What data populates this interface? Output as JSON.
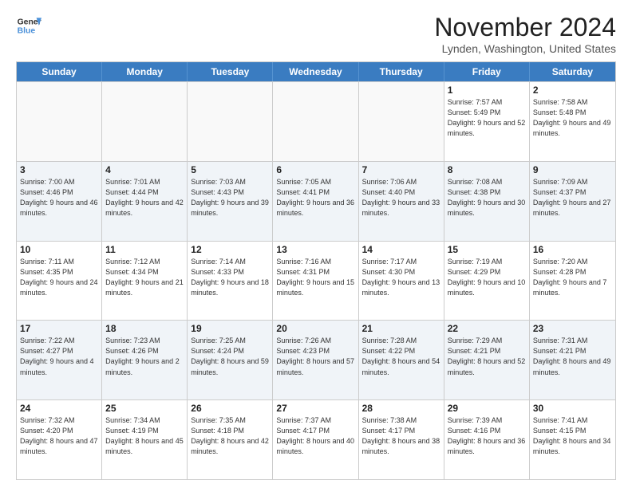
{
  "logo": {
    "line1": "General",
    "line2": "Blue"
  },
  "title": "November 2024",
  "location": "Lynden, Washington, United States",
  "days_of_week": [
    "Sunday",
    "Monday",
    "Tuesday",
    "Wednesday",
    "Thursday",
    "Friday",
    "Saturday"
  ],
  "weeks": [
    [
      {
        "day": "",
        "sunrise": "",
        "sunset": "",
        "daylight": ""
      },
      {
        "day": "",
        "sunrise": "",
        "sunset": "",
        "daylight": ""
      },
      {
        "day": "",
        "sunrise": "",
        "sunset": "",
        "daylight": ""
      },
      {
        "day": "",
        "sunrise": "",
        "sunset": "",
        "daylight": ""
      },
      {
        "day": "",
        "sunrise": "",
        "sunset": "",
        "daylight": ""
      },
      {
        "day": "1",
        "sunrise": "Sunrise: 7:57 AM",
        "sunset": "Sunset: 5:49 PM",
        "daylight": "Daylight: 9 hours and 52 minutes."
      },
      {
        "day": "2",
        "sunrise": "Sunrise: 7:58 AM",
        "sunset": "Sunset: 5:48 PM",
        "daylight": "Daylight: 9 hours and 49 minutes."
      }
    ],
    [
      {
        "day": "3",
        "sunrise": "Sunrise: 7:00 AM",
        "sunset": "Sunset: 4:46 PM",
        "daylight": "Daylight: 9 hours and 46 minutes."
      },
      {
        "day": "4",
        "sunrise": "Sunrise: 7:01 AM",
        "sunset": "Sunset: 4:44 PM",
        "daylight": "Daylight: 9 hours and 42 minutes."
      },
      {
        "day": "5",
        "sunrise": "Sunrise: 7:03 AM",
        "sunset": "Sunset: 4:43 PM",
        "daylight": "Daylight: 9 hours and 39 minutes."
      },
      {
        "day": "6",
        "sunrise": "Sunrise: 7:05 AM",
        "sunset": "Sunset: 4:41 PM",
        "daylight": "Daylight: 9 hours and 36 minutes."
      },
      {
        "day": "7",
        "sunrise": "Sunrise: 7:06 AM",
        "sunset": "Sunset: 4:40 PM",
        "daylight": "Daylight: 9 hours and 33 minutes."
      },
      {
        "day": "8",
        "sunrise": "Sunrise: 7:08 AM",
        "sunset": "Sunset: 4:38 PM",
        "daylight": "Daylight: 9 hours and 30 minutes."
      },
      {
        "day": "9",
        "sunrise": "Sunrise: 7:09 AM",
        "sunset": "Sunset: 4:37 PM",
        "daylight": "Daylight: 9 hours and 27 minutes."
      }
    ],
    [
      {
        "day": "10",
        "sunrise": "Sunrise: 7:11 AM",
        "sunset": "Sunset: 4:35 PM",
        "daylight": "Daylight: 9 hours and 24 minutes."
      },
      {
        "day": "11",
        "sunrise": "Sunrise: 7:12 AM",
        "sunset": "Sunset: 4:34 PM",
        "daylight": "Daylight: 9 hours and 21 minutes."
      },
      {
        "day": "12",
        "sunrise": "Sunrise: 7:14 AM",
        "sunset": "Sunset: 4:33 PM",
        "daylight": "Daylight: 9 hours and 18 minutes."
      },
      {
        "day": "13",
        "sunrise": "Sunrise: 7:16 AM",
        "sunset": "Sunset: 4:31 PM",
        "daylight": "Daylight: 9 hours and 15 minutes."
      },
      {
        "day": "14",
        "sunrise": "Sunrise: 7:17 AM",
        "sunset": "Sunset: 4:30 PM",
        "daylight": "Daylight: 9 hours and 13 minutes."
      },
      {
        "day": "15",
        "sunrise": "Sunrise: 7:19 AM",
        "sunset": "Sunset: 4:29 PM",
        "daylight": "Daylight: 9 hours and 10 minutes."
      },
      {
        "day": "16",
        "sunrise": "Sunrise: 7:20 AM",
        "sunset": "Sunset: 4:28 PM",
        "daylight": "Daylight: 9 hours and 7 minutes."
      }
    ],
    [
      {
        "day": "17",
        "sunrise": "Sunrise: 7:22 AM",
        "sunset": "Sunset: 4:27 PM",
        "daylight": "Daylight: 9 hours and 4 minutes."
      },
      {
        "day": "18",
        "sunrise": "Sunrise: 7:23 AM",
        "sunset": "Sunset: 4:26 PM",
        "daylight": "Daylight: 9 hours and 2 minutes."
      },
      {
        "day": "19",
        "sunrise": "Sunrise: 7:25 AM",
        "sunset": "Sunset: 4:24 PM",
        "daylight": "Daylight: 8 hours and 59 minutes."
      },
      {
        "day": "20",
        "sunrise": "Sunrise: 7:26 AM",
        "sunset": "Sunset: 4:23 PM",
        "daylight": "Daylight: 8 hours and 57 minutes."
      },
      {
        "day": "21",
        "sunrise": "Sunrise: 7:28 AM",
        "sunset": "Sunset: 4:22 PM",
        "daylight": "Daylight: 8 hours and 54 minutes."
      },
      {
        "day": "22",
        "sunrise": "Sunrise: 7:29 AM",
        "sunset": "Sunset: 4:21 PM",
        "daylight": "Daylight: 8 hours and 52 minutes."
      },
      {
        "day": "23",
        "sunrise": "Sunrise: 7:31 AM",
        "sunset": "Sunset: 4:21 PM",
        "daylight": "Daylight: 8 hours and 49 minutes."
      }
    ],
    [
      {
        "day": "24",
        "sunrise": "Sunrise: 7:32 AM",
        "sunset": "Sunset: 4:20 PM",
        "daylight": "Daylight: 8 hours and 47 minutes."
      },
      {
        "day": "25",
        "sunrise": "Sunrise: 7:34 AM",
        "sunset": "Sunset: 4:19 PM",
        "daylight": "Daylight: 8 hours and 45 minutes."
      },
      {
        "day": "26",
        "sunrise": "Sunrise: 7:35 AM",
        "sunset": "Sunset: 4:18 PM",
        "daylight": "Daylight: 8 hours and 42 minutes."
      },
      {
        "day": "27",
        "sunrise": "Sunrise: 7:37 AM",
        "sunset": "Sunset: 4:17 PM",
        "daylight": "Daylight: 8 hours and 40 minutes."
      },
      {
        "day": "28",
        "sunrise": "Sunrise: 7:38 AM",
        "sunset": "Sunset: 4:17 PM",
        "daylight": "Daylight: 8 hours and 38 minutes."
      },
      {
        "day": "29",
        "sunrise": "Sunrise: 7:39 AM",
        "sunset": "Sunset: 4:16 PM",
        "daylight": "Daylight: 8 hours and 36 minutes."
      },
      {
        "day": "30",
        "sunrise": "Sunrise: 7:41 AM",
        "sunset": "Sunset: 4:15 PM",
        "daylight": "Daylight: 8 hours and 34 minutes."
      }
    ]
  ]
}
